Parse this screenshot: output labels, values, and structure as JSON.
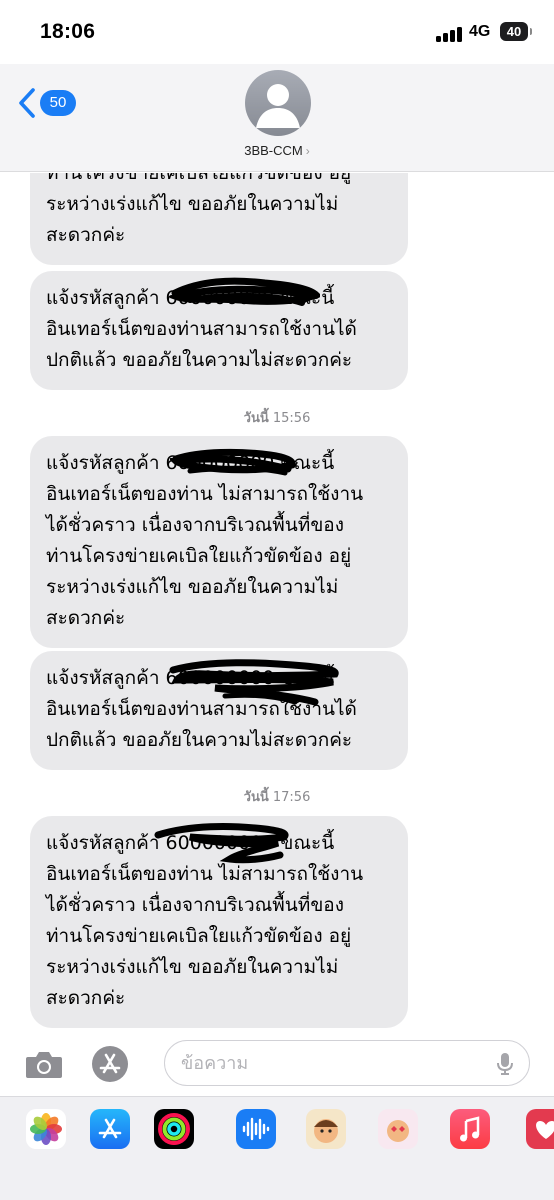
{
  "status_bar": {
    "time": "18:06",
    "network": "4G",
    "battery": "40"
  },
  "header": {
    "back_count": "50",
    "contact_name": "3BB-CCM",
    "contact_chevron": "›"
  },
  "messages": [
    {
      "type": "bubble",
      "text": "ท่านโครงข่ายเคเบิลใยแก้วขัดข้อง อยู่\nระหว่างเร่งแก้ไข ขออภัยในความไม่\nสะดวกค่ะ"
    },
    {
      "type": "bubble",
      "text": "แจ้งรหัสลูกค้า 600000000 ขณะนี้\nอินเทอร์เน็ตของท่านสามารถใช้งานได้\nปกติแล้ว ขออภัยในความไม่สะดวกค่ะ"
    },
    {
      "type": "timestamp",
      "day": "วันนี้",
      "time": "15:56"
    },
    {
      "type": "bubble",
      "text": "แจ้งรหัสลูกค้า 600000000 ขณะนี้\nอินเทอร์เน็ตของท่าน ไม่สามารถใช้งาน\nได้ชั่วคราว เนื่องจากบริเวณพื้นที่ของ\nท่านโครงข่ายเคเบิลใยแก้วขัดข้อง อยู่\nระหว่างเร่งแก้ไข ขออภัยในความไม่\nสะดวกค่ะ"
    },
    {
      "type": "bubble",
      "text": "แจ้งรหัสลูกค้า 600000000 ขณะนี้\nอินเทอร์เน็ตของท่านสามารถใช้งานได้\nปกติแล้ว ขออภัยในความไม่สะดวกค่ะ"
    },
    {
      "type": "timestamp",
      "day": "วันนี้",
      "time": "17:56"
    },
    {
      "type": "bubble",
      "text": "แจ้งรหัสลูกค้า 600000000 ขณะนี้\nอินเทอร์เน็ตของท่าน ไม่สามารถใช้งาน\nได้ชั่วคราว เนื่องจากบริเวณพื้นที่ของ\nท่านโครงข่ายเคเบิลใยแก้วขัดข้อง อยู่\nระหว่างเร่งแก้ไข ขออภัยในความไม่\nสะดวกค่ะ"
    }
  ],
  "input": {
    "placeholder": "ข้อความ"
  },
  "icons": {
    "back": "chevron-left-icon",
    "camera": "camera-icon",
    "app_store": "app-store-icon",
    "mic": "microphone-icon"
  },
  "app_drawer": [
    {
      "name": "photos",
      "color": "#ffffff"
    },
    {
      "name": "app-store",
      "color": "#1c8ef9"
    },
    {
      "name": "activity",
      "color": "#000000"
    },
    {
      "name": "audio-message",
      "color": "#1a7df5"
    },
    {
      "name": "memoji-1",
      "color": "#f5e6c8"
    },
    {
      "name": "memoji-2",
      "color": "#f8e8f0"
    },
    {
      "name": "music",
      "color": "#fc3c44"
    },
    {
      "name": "heart-sticker",
      "color": "#e33a4f"
    }
  ],
  "colors": {
    "accent": "#1a7df5",
    "bubble": "#e9e9eb",
    "header_bg": "#f4f4f6",
    "timestamp": "#8a8a8e"
  }
}
